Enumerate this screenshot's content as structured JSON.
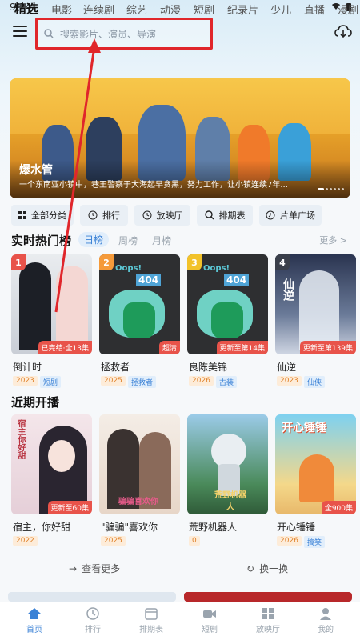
{
  "status": {
    "time": "9:24"
  },
  "search": {
    "placeholder": "搜索影片、演员、导演"
  },
  "tabs": [
    "精选",
    "电影",
    "连续剧",
    "综艺",
    "动漫",
    "短剧",
    "纪录片",
    "少儿",
    "直播",
    "漫剧"
  ],
  "banner": {
    "title": "爆水管",
    "desc": "一个东南亚小镇中，巷王警察于大海起早贪黑，努力工作，让小镇连续7年..."
  },
  "quick": [
    "全部分类",
    "排行",
    "放映厅",
    "排期表",
    "片单广场"
  ],
  "hot": {
    "title": "实时热门榜",
    "tabs": [
      "日榜",
      "周榜",
      "月榜"
    ],
    "more": "更多 >",
    "items": [
      {
        "rank": "1",
        "title": "倒计时",
        "year": "2023",
        "cat": "短剧",
        "status": "已完结·全13集"
      },
      {
        "rank": "2",
        "title": "拯救者",
        "year": "2025",
        "cat": "拯救者",
        "status": "超清"
      },
      {
        "rank": "3",
        "title": "良陈美锦",
        "year": "2026",
        "cat": "古装",
        "status": "更新至第14集"
      },
      {
        "rank": "4",
        "title": "仙逆",
        "year": "2023",
        "cat": "仙侠",
        "status": "更新至第139集"
      }
    ]
  },
  "upcoming": {
    "title": "近期开播",
    "items": [
      {
        "title": "宿主，你好甜",
        "year": "2022",
        "cat": "",
        "status": "更新至60集"
      },
      {
        "title": "\"骗骗\"喜欢你",
        "year": "2025",
        "cat": "",
        "status": ""
      },
      {
        "title": "荒野机器人",
        "year": "0",
        "cat": "",
        "status": ""
      },
      {
        "title": "开心锤锤",
        "year": "2026",
        "cat": "搞笑",
        "status": "全900集"
      }
    ]
  },
  "posterText": {
    "oops": "Oops!",
    "code": "404",
    "xianni": "仙逆",
    "wild": "荒野机器人",
    "happy": "开心锤锤",
    "sweet": "宿主你好甜",
    "cheat": "骗骗喜欢你"
  },
  "links": {
    "more": "查看更多",
    "refresh": "换一换"
  },
  "nav": [
    "首页",
    "排行",
    "排期表",
    "短剧",
    "放映厅",
    "我的"
  ],
  "colors": {
    "accent": "#3b82d6",
    "red": "#e0262b"
  }
}
